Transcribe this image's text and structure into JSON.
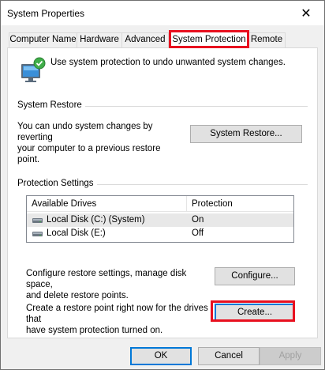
{
  "window": {
    "title": "System Properties",
    "close_glyph": "✕"
  },
  "tabs": [
    {
      "label": "Computer Name"
    },
    {
      "label": "Hardware"
    },
    {
      "label": "Advanced"
    },
    {
      "label": "System Protection",
      "active": true
    },
    {
      "label": "Remote"
    }
  ],
  "intro": {
    "icon": "computer-protection-icon",
    "text": "Use system protection to undo unwanted system changes."
  },
  "system_restore": {
    "group_label": "System Restore",
    "description_line1": "You can undo system changes by reverting",
    "description_line2": "your computer to a previous restore point.",
    "button_label": "System Restore..."
  },
  "protection_settings": {
    "group_label": "Protection Settings",
    "columns": [
      "Available Drives",
      "Protection"
    ],
    "drives": [
      {
        "icon": "disk-drive-icon",
        "name": "Local Disk (C:) (System)",
        "protection": "On"
      },
      {
        "icon": "disk-drive-icon",
        "name": "Local Disk (E:)",
        "protection": "Off"
      }
    ],
    "configure_text_line1": "Configure restore settings, manage disk space,",
    "configure_text_line2": "and delete restore points.",
    "configure_button": "Configure...",
    "create_text_line1": "Create a restore point right now for the drives that",
    "create_text_line2": "have system protection turned on.",
    "create_button": "Create..."
  },
  "footer": {
    "ok": "OK",
    "cancel": "Cancel",
    "apply": "Apply"
  },
  "colors": {
    "highlight": "#e8101f",
    "accent": "#0078d7"
  }
}
